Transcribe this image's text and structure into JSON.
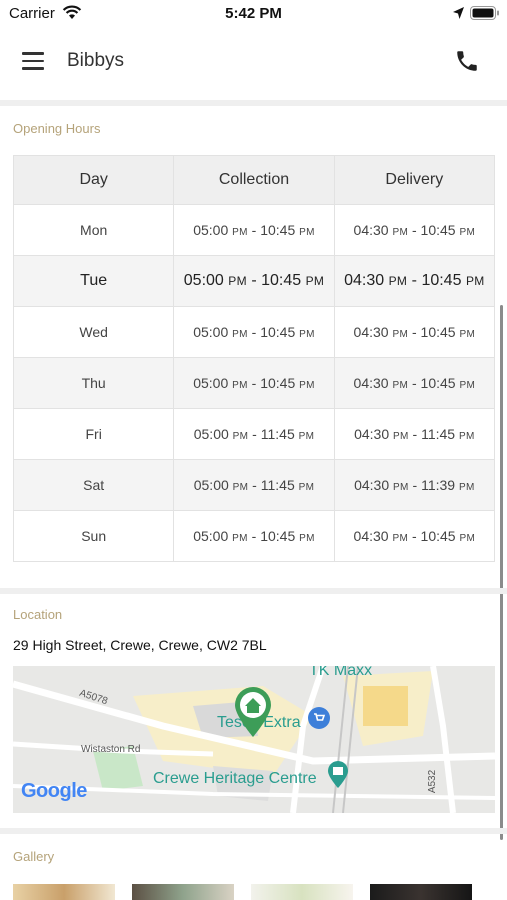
{
  "status_bar": {
    "carrier": "Carrier",
    "time": "5:42 PM"
  },
  "header": {
    "title": "Bibbys"
  },
  "opening_hours": {
    "heading": "Opening Hours",
    "columns": [
      "Day",
      "Collection",
      "Delivery"
    ],
    "rows": [
      {
        "day": "Mon",
        "collection_open": "05:00",
        "collection_open_ampm": "PM",
        "collection_close": "10:45",
        "collection_close_ampm": "PM",
        "delivery_open": "04:30",
        "delivery_open_ampm": "PM",
        "delivery_close": "10:45",
        "delivery_close_ampm": "PM"
      },
      {
        "day": "Tue",
        "collection_open": "05:00",
        "collection_open_ampm": "PM",
        "collection_close": "10:45",
        "collection_close_ampm": "PM",
        "delivery_open": "04:30",
        "delivery_open_ampm": "PM",
        "delivery_close": "10:45",
        "delivery_close_ampm": "PM"
      },
      {
        "day": "Wed",
        "collection_open": "05:00",
        "collection_open_ampm": "PM",
        "collection_close": "10:45",
        "collection_close_ampm": "PM",
        "delivery_open": "04:30",
        "delivery_open_ampm": "PM",
        "delivery_close": "10:45",
        "delivery_close_ampm": "PM"
      },
      {
        "day": "Thu",
        "collection_open": "05:00",
        "collection_open_ampm": "PM",
        "collection_close": "10:45",
        "collection_close_ampm": "PM",
        "delivery_open": "04:30",
        "delivery_open_ampm": "PM",
        "delivery_close": "10:45",
        "delivery_close_ampm": "PM"
      },
      {
        "day": "Fri",
        "collection_open": "05:00",
        "collection_open_ampm": "PM",
        "collection_close": "11:45",
        "collection_close_ampm": "PM",
        "delivery_open": "04:30",
        "delivery_open_ampm": "PM",
        "delivery_close": "11:45",
        "delivery_close_ampm": "PM"
      },
      {
        "day": "Sat",
        "collection_open": "05:00",
        "collection_open_ampm": "PM",
        "collection_close": "11:45",
        "collection_close_ampm": "PM",
        "delivery_open": "04:30",
        "delivery_open_ampm": "PM",
        "delivery_close": "11:39",
        "delivery_close_ampm": "PM"
      },
      {
        "day": "Sun",
        "collection_open": "05:00",
        "collection_open_ampm": "PM",
        "collection_close": "10:45",
        "collection_close_ampm": "PM",
        "delivery_open": "04:30",
        "delivery_open_ampm": "PM",
        "delivery_close": "10:45",
        "delivery_close_ampm": "PM"
      }
    ],
    "highlighted_day": "Tue"
  },
  "location": {
    "heading": "Location",
    "address": "29 High Street, Crewe, Crewe, CW2 7BL",
    "map": {
      "road_labels": [
        "A5078",
        "Wistaston Rd",
        "A532"
      ],
      "places": [
        "TK Maxx",
        "Tesco Extra",
        "Crewe Heritage Centre"
      ],
      "attribution": "Google",
      "marker_icon": "home-pin-icon"
    }
  },
  "gallery": {
    "heading": "Gallery"
  },
  "colors": {
    "section_heading": "#b5a37a",
    "map_poi": "#2a9d8f",
    "marker": "#3d9d58"
  }
}
